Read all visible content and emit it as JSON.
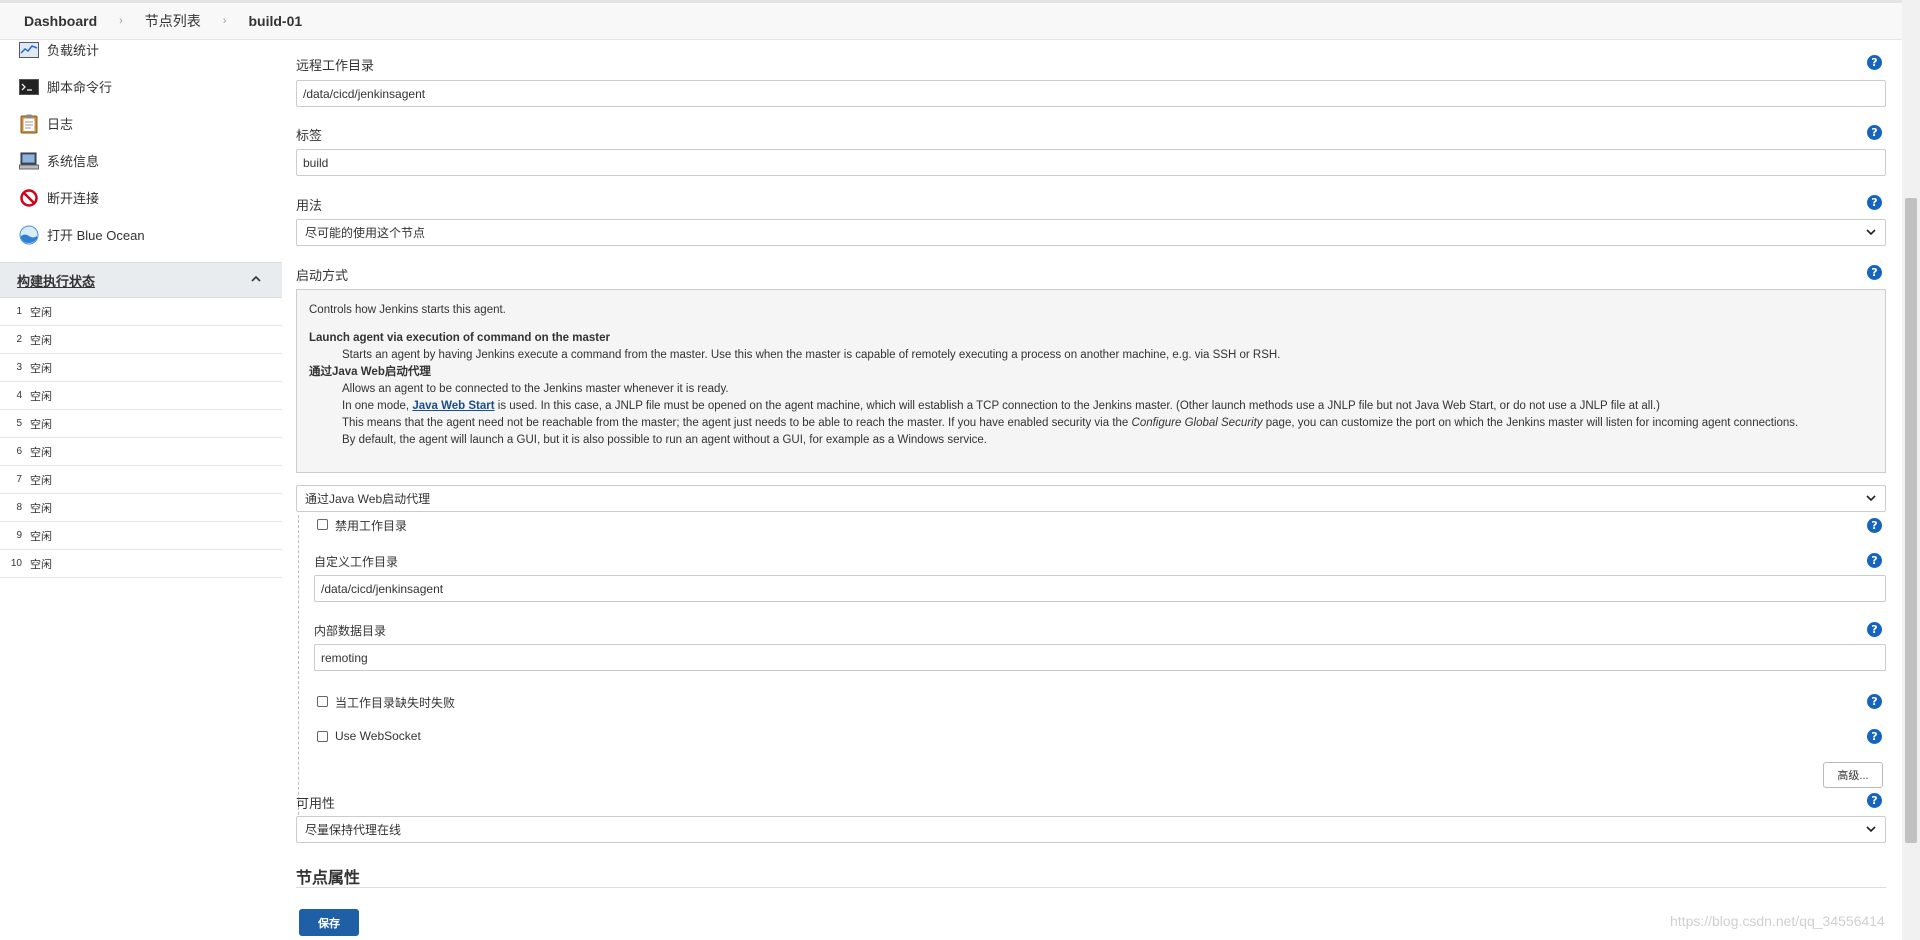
{
  "breadcrumb": {
    "items": [
      "Dashboard",
      "节点列表",
      "build-01"
    ]
  },
  "sidebar": {
    "tasks": [
      {
        "label": "负载统计",
        "icon": "load-stats-icon"
      },
      {
        "label": "脚本命令行",
        "icon": "terminal-icon"
      },
      {
        "label": "日志",
        "icon": "clipboard-icon"
      },
      {
        "label": "系统信息",
        "icon": "computer-icon"
      },
      {
        "label": "断开连接",
        "icon": "no-entry-icon"
      },
      {
        "label": "打开 Blue Ocean",
        "icon": "blue-ocean-icon"
      }
    ],
    "executor_header": "构建执行状态",
    "executors": [
      {
        "num": "1",
        "status": "空闲"
      },
      {
        "num": "2",
        "status": "空闲"
      },
      {
        "num": "3",
        "status": "空闲"
      },
      {
        "num": "4",
        "status": "空闲"
      },
      {
        "num": "5",
        "status": "空闲"
      },
      {
        "num": "6",
        "status": "空闲"
      },
      {
        "num": "7",
        "status": "空闲"
      },
      {
        "num": "8",
        "status": "空闲"
      },
      {
        "num": "9",
        "status": "空闲"
      },
      {
        "num": "10",
        "status": "空闲"
      }
    ]
  },
  "form": {
    "remote_dir_label": "远程工作目录",
    "remote_dir_value": "/data/cicd/jenkinsagent",
    "labels_label": "标签",
    "labels_value": "build",
    "usage_label": "用法",
    "usage_value": "尽可能的使用这个节点",
    "launch_label": "启动方式",
    "help": {
      "intro": "Controls how Jenkins starts this agent.",
      "opt1_title": "Launch agent via execution of command on the master",
      "opt1_desc": "Starts an agent by having Jenkins execute a command from the master. Use this when the master is capable of remotely executing a process on another machine, e.g. via SSH or RSH.",
      "opt2_title": "通过Java Web启动代理",
      "opt2_line1": "Allows an agent to be connected to the Jenkins master whenever it is ready.",
      "opt2_line2_pre": "In one mode, ",
      "opt2_line2_link": "Java Web Start",
      "opt2_line2_post": " is used. In this case, a JNLP file must be opened on the agent machine, which will establish a TCP connection to the Jenkins master. (Other launch methods use a JNLP file but not Java Web Start, or do not use a JNLP file at all.)",
      "opt2_line3_pre": "This means that the agent need not be reachable from the master; the agent just needs to be able to reach the master. If you have enabled security via the ",
      "opt2_line3_em": "Configure Global Security",
      "opt2_line3_post": " page, you can customize the port on which the Jenkins master will listen for incoming agent connections.",
      "opt2_line4": "By default, the agent will launch a GUI, but it is also possible to run an agent without a GUI, for example as a Windows service."
    },
    "launch_value": "通过Java Web启动代理",
    "disable_workdir_label": "禁用工作目录",
    "custom_workdir_label": "自定义工作目录",
    "custom_workdir_value": "/data/cicd/jenkinsagent",
    "internal_dir_label": "内部数据目录",
    "internal_dir_value": "remoting",
    "fail_if_missing_label": "当工作目录缺失时失败",
    "websocket_label": "Use WebSocket",
    "advanced_button": "高级...",
    "availability_label": "可用性",
    "availability_value": "尽量保持代理在线",
    "node_props_title": "节点属性",
    "save_button": "保存"
  },
  "watermark": "https://blog.csdn.net/qq_34556414",
  "colors": {
    "accent": "#1f5fa6",
    "help": "#1565c0"
  }
}
